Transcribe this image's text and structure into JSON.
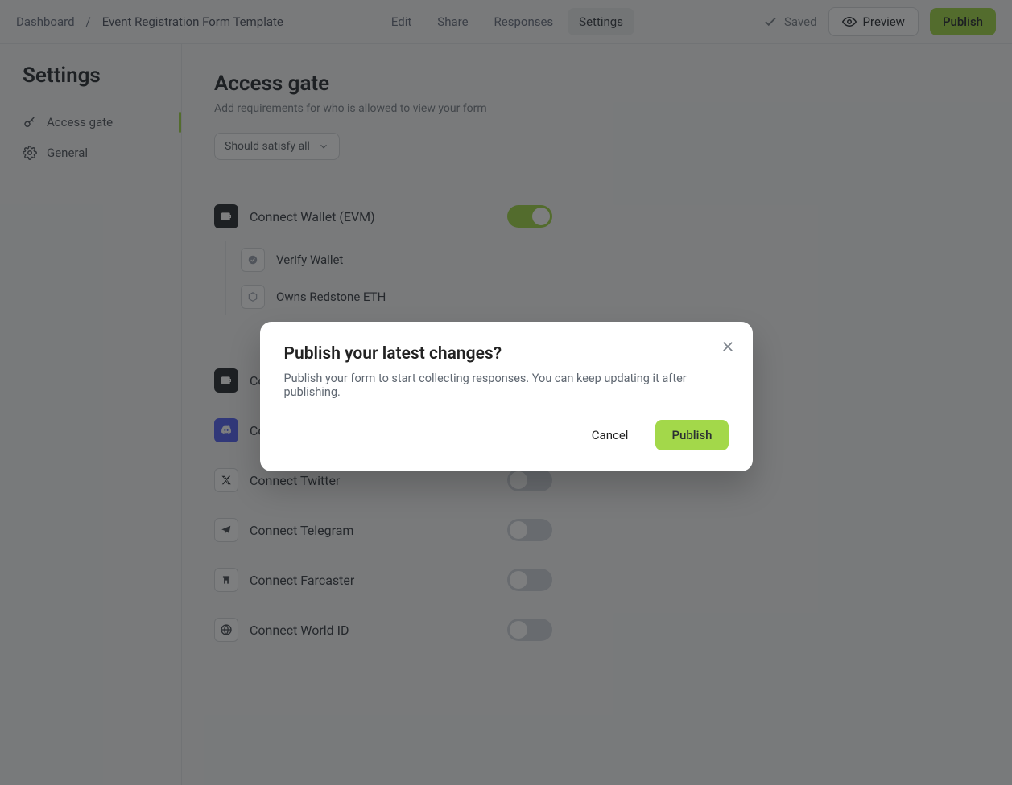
{
  "breadcrumb": {
    "root": "Dashboard",
    "sep": "/",
    "current": "Event Registration Form Template"
  },
  "tabs": {
    "edit": "Edit",
    "share": "Share",
    "responses": "Responses",
    "settings": "Settings"
  },
  "topbar": {
    "saved": "Saved",
    "preview": "Preview",
    "publish": "Publish"
  },
  "sidebar": {
    "title": "Settings",
    "items": [
      {
        "label": "Access gate"
      },
      {
        "label": "General"
      }
    ]
  },
  "page": {
    "title": "Access gate",
    "subtitle": "Add requirements for who is allowed to view your form",
    "rule_select": "Should satisfy all"
  },
  "gates": {
    "evm": {
      "label": "Connect Wallet (EVM)",
      "on": true,
      "children": [
        {
          "label": "Verify Wallet"
        },
        {
          "label": "Owns Redstone ETH"
        }
      ]
    },
    "sol": {
      "label": "Connect Wallet (SOL)",
      "on": false
    },
    "discord": {
      "label": "Connect Discord",
      "on": true
    },
    "twitter": {
      "label": "Connect Twitter",
      "on": false
    },
    "telegram": {
      "label": "Connect Telegram",
      "on": false
    },
    "farcaster": {
      "label": "Connect Farcaster",
      "on": false
    },
    "worldid": {
      "label": "Connect World ID",
      "on": false
    }
  },
  "modal": {
    "title": "Publish your latest changes?",
    "body": "Publish your form to start collecting responses. You can keep updating it after publishing.",
    "cancel": "Cancel",
    "confirm": "Publish"
  }
}
